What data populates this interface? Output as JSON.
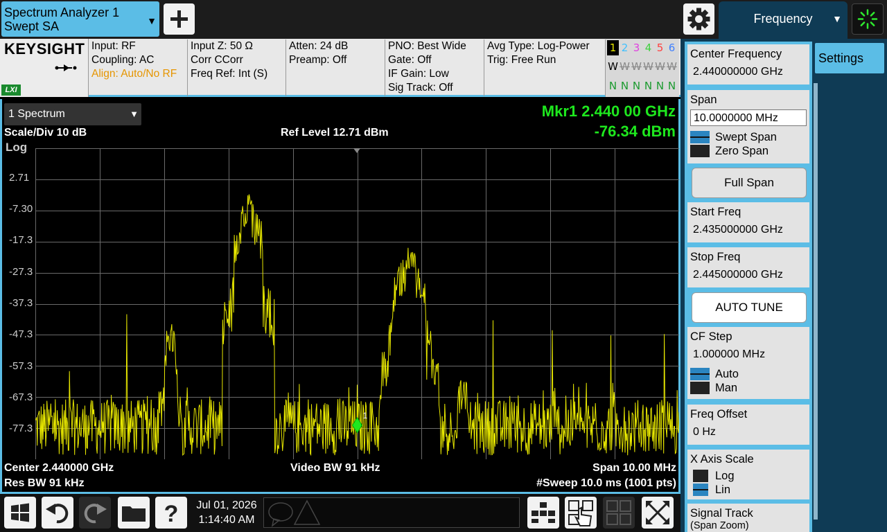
{
  "app_tab": {
    "line1": "Spectrum Analyzer 1",
    "line2": "Swept SA"
  },
  "icons": {
    "add": "plus-icon",
    "settings": "gear-icon",
    "busy": "busy-spinner-icon"
  },
  "freq_tab": {
    "label": "Frequency"
  },
  "info": {
    "brand": "KEYSIGHT",
    "lxi": "LXI",
    "col1": [
      "Input: RF",
      "Coupling: AC",
      "Align: Auto/No RF"
    ],
    "col2": [
      "Input Z: 50 Ω",
      "Corr CCorr",
      "Freq Ref: Int (S)"
    ],
    "col3": [
      "Atten: 24 dB",
      "Preamp: Off"
    ],
    "col4": [
      "PNO: Best Wide",
      "Gate: Off",
      "IF Gain: Low",
      "Sig Track: Off"
    ],
    "col5": [
      "Avg Type: Log-Power",
      "Trig: Free Run"
    ],
    "traces": {
      "numbers": [
        "1",
        "2",
        "3",
        "4",
        "5",
        "6"
      ],
      "modes": [
        "W",
        "W",
        "W",
        "W",
        "W",
        "W"
      ],
      "detectors": [
        "N",
        "N",
        "N",
        "N",
        "N",
        "N"
      ],
      "colors": [
        "#e8e800",
        "#3fc0ff",
        "#e040e0",
        "#3fd03f",
        "#ff4040",
        "#4080ff"
      ]
    }
  },
  "plot": {
    "window_select": "1 Spectrum",
    "scale_div": "Scale/Div 10 dB",
    "log": "Log",
    "ref_level": "Ref Level 12.71 dBm",
    "marker_line1": "Mkr1  2.440 00 GHz",
    "marker_line2": "-76.34 dBm",
    "center": "Center 2.440000 GHz",
    "res_bw": "Res BW 91 kHz",
    "video_bw": "Video BW 91 kHz",
    "span": "Span 10.00 MHz",
    "sweep": "#Sweep 10.0 ms (1001 pts)",
    "marker_label": "1"
  },
  "chart_data": {
    "type": "line",
    "series": [
      {
        "name": "1",
        "color": "#e8e800"
      }
    ],
    "x_range_ghz": [
      2.435,
      2.445
    ],
    "y_range_dbm": [
      -87.29,
      12.71
    ],
    "ytick_labels": [
      "2.71",
      "-7.30",
      "-17.3",
      "-27.3",
      "-37.3",
      "-47.3",
      "-57.3",
      "-67.3",
      "-77.3"
    ],
    "ytick_values": [
      2.71,
      -7.3,
      -17.3,
      -27.3,
      -37.3,
      -47.3,
      -57.3,
      -67.3,
      -77.3
    ],
    "noise_floor_dbm": -77,
    "features": [
      {
        "x_ghz": 2.43831,
        "peak_dbm": 4.5,
        "width_mhz": 0.45
      },
      {
        "x_ghz": 2.44081,
        "peak_dbm": -11.0,
        "width_mhz": 0.5
      },
      {
        "x_ghz": 2.4371,
        "peak_dbm": -32.0,
        "width_mhz": 0.2
      },
      {
        "x_ghz": 2.44165,
        "peak_dbm": -50.0,
        "width_mhz": 0.2
      }
    ],
    "spurs": [
      {
        "x_ghz": 2.43642,
        "peak_dbm": -39.0
      },
      {
        "x_ghz": 2.44211,
        "peak_dbm": -40.0
      },
      {
        "x_ghz": 2.44394,
        "peak_dbm": -45.0
      },
      {
        "x_ghz": 2.44303,
        "peak_dbm": -45.0
      },
      {
        "x_ghz": 2.44477,
        "peak_dbm": -47.0
      },
      {
        "x_ghz": 2.43553,
        "peak_dbm": -58.0
      }
    ],
    "marker": {
      "x_ghz": 2.44,
      "y_dbm": -76.34
    }
  },
  "taskbar": {
    "icons": [
      "windows-start-icon",
      "undo-icon",
      "redo-icon",
      "folder-icon",
      "help-icon"
    ],
    "date": "Jul 01, 2026",
    "time": "1:14:40 AM",
    "right_icons": [
      "layout-icon",
      "touch-icon",
      "multiwindow-icon",
      "fullscreen-icon"
    ]
  },
  "panel": {
    "tab": "Settings",
    "center_freq": {
      "title": "Center Frequency",
      "value": "2.440000000 GHz"
    },
    "span": {
      "title": "Span",
      "value": "10.0000000 MHz",
      "opt1": "Swept Span",
      "opt2": "Zero Span"
    },
    "full_span": "Full Span",
    "start_freq": {
      "title": "Start Freq",
      "value": "2.435000000 GHz"
    },
    "stop_freq": {
      "title": "Stop Freq",
      "value": "2.445000000 GHz"
    },
    "auto_tune": "AUTO TUNE",
    "cf_step": {
      "title": "CF Step",
      "value": "1.000000 MHz",
      "opt1": "Auto",
      "opt2": "Man"
    },
    "freq_offset": {
      "title": "Freq Offset",
      "value": "0 Hz"
    },
    "x_axis_scale": {
      "title": "X Axis Scale",
      "opt1": "Log",
      "opt2": "Lin"
    },
    "signal_track": {
      "title": "Signal Track",
      "sub": "(Span Zoom)"
    }
  }
}
